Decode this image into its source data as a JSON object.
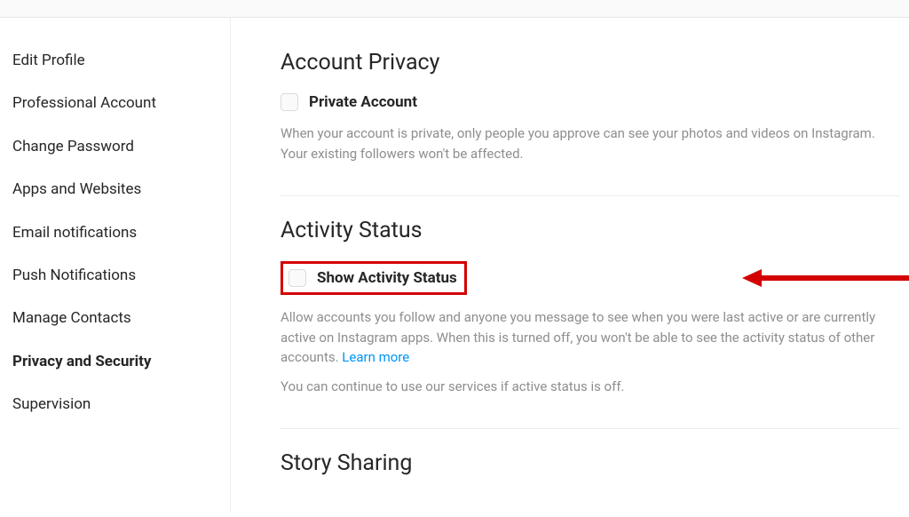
{
  "sidebar": {
    "items": [
      {
        "label": "Edit Profile",
        "active": false
      },
      {
        "label": "Professional Account",
        "active": false
      },
      {
        "label": "Change Password",
        "active": false
      },
      {
        "label": "Apps and Websites",
        "active": false
      },
      {
        "label": "Email notifications",
        "active": false
      },
      {
        "label": "Push Notifications",
        "active": false
      },
      {
        "label": "Manage Contacts",
        "active": false
      },
      {
        "label": "Privacy and Security",
        "active": true
      },
      {
        "label": "Supervision",
        "active": false
      }
    ]
  },
  "sections": {
    "accountPrivacy": {
      "title": "Account Privacy",
      "checkboxLabel": "Private Account",
      "description": "When your account is private, only people you approve can see your photos and videos on Instagram. Your existing followers won't be affected."
    },
    "activityStatus": {
      "title": "Activity Status",
      "checkboxLabel": "Show Activity Status",
      "description1": "Allow accounts you follow and anyone you message to see when you were last active or are currently active on Instagram apps. When this is turned off, you won't be able to see the activity status of other accounts. ",
      "learnMore": "Learn more",
      "description2": "You can continue to use our services if active status is off."
    },
    "storySharing": {
      "title": "Story Sharing"
    }
  },
  "annotation": {
    "highlightColor": "#d40000"
  }
}
